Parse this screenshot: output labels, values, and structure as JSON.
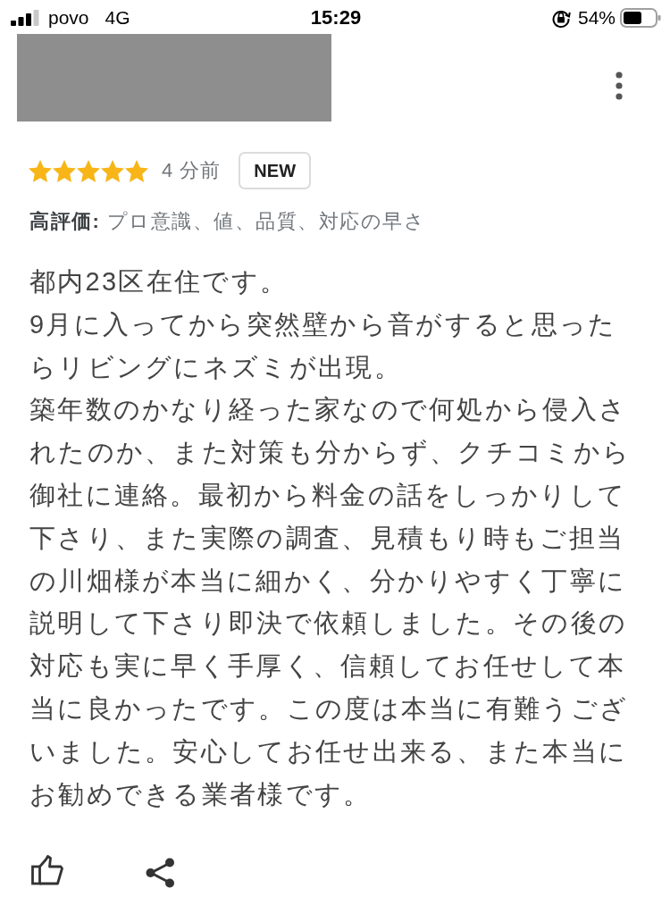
{
  "status_bar": {
    "carrier": "povo",
    "network": "4G",
    "time": "15:29",
    "battery": "54%"
  },
  "review": {
    "stars": 5,
    "time_ago": "4 分前",
    "badge": "NEW",
    "highlights": "**高評価:** プロ意識、値、品質、対応の早さ",
    "paragraphs": [
      "都内23区在住です。",
      "9月に入ってから突然壁から音がすると思ったらリビングにネズミが出現。",
      "築年数のかなり経った家なので何処から侵入されたのか、また対策も分からず、クチコミから御社に連絡。最初から料金の話をしっかりして下さり、また実際の調査、見積もり時もご担当の川畑様が本当に細かく、分かりやすく丁寧に説明して下さり即決で依頼しました。その後の対応も実に早く手厚く、信頼してお任せして本当に良かったです。この度は本当に有難うございました。安心してお任せ出来る、また本当にお勧めできる業者様です。"
    ]
  }
}
